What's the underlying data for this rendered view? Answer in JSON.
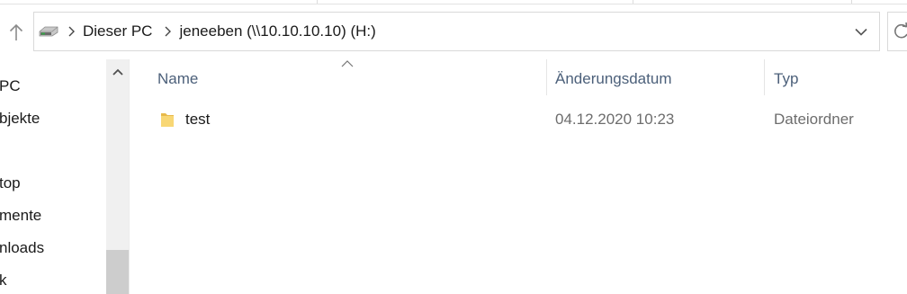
{
  "address_bar": {
    "location_icon": "network-drive-icon",
    "crumbs": [
      "Dieser PC",
      "jeneeben (\\\\10.10.10.10) (H:)"
    ]
  },
  "navigation_pane": {
    "items": [
      "PC",
      "bjekte",
      "",
      "top",
      "mente",
      "nloads",
      "k"
    ]
  },
  "file_list": {
    "columns": {
      "name": "Name",
      "date": "Änderungsdatum",
      "type": "Typ"
    },
    "sort_column": "Name",
    "rows": [
      {
        "name": "test",
        "date": "04.12.2020 10:23",
        "type": "Dateiordner",
        "icon": "folder-icon"
      }
    ]
  },
  "colors": {
    "header_text": "#4c607a",
    "folder": "#f8d775",
    "drive_green": "#3aa34a"
  }
}
